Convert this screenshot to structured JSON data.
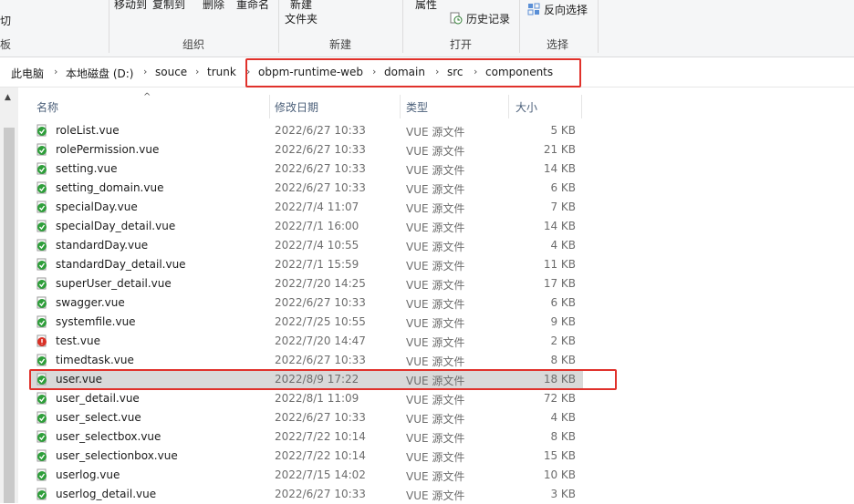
{
  "ribbon": {
    "clipboard_cut": "切",
    "clipboard_group": "板",
    "move_to": "移动到",
    "copy_to": "复制到",
    "delete": "删除",
    "rename": "重命名",
    "new_folder_line1": "新建",
    "new_folder_line2": "文件夹",
    "properties": "属性",
    "history": "历史记录",
    "invert_selection": "反向选择",
    "groups": {
      "organize": "组织",
      "new": "新建",
      "open": "打开",
      "select": "选择"
    }
  },
  "address": {
    "crumbs": [
      "此电脑",
      "本地磁盘 (D:)",
      "souce",
      "trunk",
      "obpm-runtime-web",
      "domain",
      "src",
      "components"
    ]
  },
  "columns": {
    "name": "名称",
    "date": "修改日期",
    "type": "类型",
    "size": "大小"
  },
  "files": [
    {
      "name": "roleList.vue",
      "date": "2022/6/27 10:33",
      "type": "VUE 源文件",
      "size": "5 KB",
      "status": "ok"
    },
    {
      "name": "rolePermission.vue",
      "date": "2022/6/27 10:33",
      "type": "VUE 源文件",
      "size": "21 KB",
      "status": "ok"
    },
    {
      "name": "setting.vue",
      "date": "2022/6/27 10:33",
      "type": "VUE 源文件",
      "size": "14 KB",
      "status": "ok"
    },
    {
      "name": "setting_domain.vue",
      "date": "2022/6/27 10:33",
      "type": "VUE 源文件",
      "size": "6 KB",
      "status": "ok"
    },
    {
      "name": "specialDay.vue",
      "date": "2022/7/4 11:07",
      "type": "VUE 源文件",
      "size": "7 KB",
      "status": "ok"
    },
    {
      "name": "specialDay_detail.vue",
      "date": "2022/7/1 16:00",
      "type": "VUE 源文件",
      "size": "14 KB",
      "status": "ok"
    },
    {
      "name": "standardDay.vue",
      "date": "2022/7/4 10:55",
      "type": "VUE 源文件",
      "size": "4 KB",
      "status": "ok"
    },
    {
      "name": "standardDay_detail.vue",
      "date": "2022/7/1 15:59",
      "type": "VUE 源文件",
      "size": "11 KB",
      "status": "ok"
    },
    {
      "name": "superUser_detail.vue",
      "date": "2022/7/20 14:25",
      "type": "VUE 源文件",
      "size": "17 KB",
      "status": "ok"
    },
    {
      "name": "swagger.vue",
      "date": "2022/6/27 10:33",
      "type": "VUE 源文件",
      "size": "6 KB",
      "status": "ok"
    },
    {
      "name": "systemfile.vue",
      "date": "2022/7/25 10:55",
      "type": "VUE 源文件",
      "size": "9 KB",
      "status": "ok"
    },
    {
      "name": "test.vue",
      "date": "2022/7/20 14:47",
      "type": "VUE 源文件",
      "size": "2 KB",
      "status": "modified"
    },
    {
      "name": "timedtask.vue",
      "date": "2022/6/27 10:33",
      "type": "VUE 源文件",
      "size": "8 KB",
      "status": "ok"
    },
    {
      "name": "user.vue",
      "date": "2022/8/9 17:22",
      "type": "VUE 源文件",
      "size": "18 KB",
      "status": "ok",
      "selected": true
    },
    {
      "name": "user_detail.vue",
      "date": "2022/8/1 11:09",
      "type": "VUE 源文件",
      "size": "72 KB",
      "status": "ok"
    },
    {
      "name": "user_select.vue",
      "date": "2022/6/27 10:33",
      "type": "VUE 源文件",
      "size": "4 KB",
      "status": "ok"
    },
    {
      "name": "user_selectbox.vue",
      "date": "2022/7/22 10:14",
      "type": "VUE 源文件",
      "size": "8 KB",
      "status": "ok"
    },
    {
      "name": "user_selectionbox.vue",
      "date": "2022/7/22 10:14",
      "type": "VUE 源文件",
      "size": "15 KB",
      "status": "ok"
    },
    {
      "name": "userlog.vue",
      "date": "2022/7/15 14:02",
      "type": "VUE 源文件",
      "size": "10 KB",
      "status": "ok"
    },
    {
      "name": "userlog_detail.vue",
      "date": "2022/6/27 10:33",
      "type": "VUE 源文件",
      "size": "3 KB",
      "status": "ok"
    }
  ],
  "colors": {
    "highlight": "#e0312b",
    "ok_icon": "#2e9e3a",
    "modified_icon": "#d93025",
    "selected_row": "#d9d9d9"
  }
}
